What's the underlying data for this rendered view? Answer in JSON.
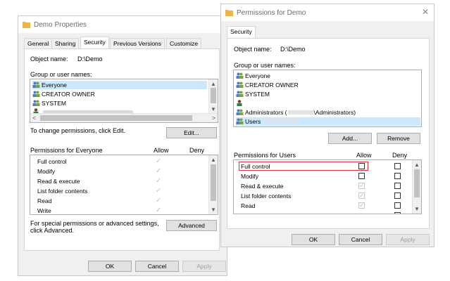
{
  "demo": {
    "title": "Demo Properties",
    "tabs": [
      "General",
      "Sharing",
      "Security",
      "Previous Versions",
      "Customize"
    ],
    "object_name_label": "Object name:",
    "object_name_value": "D:\\Demo",
    "group_label": "Group or user names:",
    "users": [
      "Everyone",
      "CREATOR OWNER",
      "SYSTEM"
    ],
    "change_text": "To change permissions, click Edit.",
    "edit_label": "Edit...",
    "perms_header": "Permissions for Everyone",
    "allow_label": "Allow",
    "deny_label": "Deny",
    "perms": [
      "Full control",
      "Modify",
      "Read & execute",
      "List folder contents",
      "Read",
      "Write"
    ],
    "special_text_1": "For special permissions or advanced settings,",
    "special_text_2": "click Advanced.",
    "advanced_label": "Advanced",
    "ok_label": "OK",
    "cancel_label": "Cancel",
    "apply_label": "Apply"
  },
  "perm": {
    "title": "Permissions for Demo",
    "tab": "Security",
    "object_name_label": "Object name:",
    "object_name_value": "D:\\Demo",
    "group_label": "Group or user names:",
    "users": [
      "Everyone",
      "CREATOR OWNER",
      "SYSTEM",
      "",
      "Administrators (",
      "\\Administrators)",
      "Users"
    ],
    "add_label": "Add...",
    "remove_label": "Remove",
    "perms_header": "Permissions for Users",
    "allow_label": "Allow",
    "deny_label": "Deny",
    "perms": [
      "Full control",
      "Modify",
      "Read & execute",
      "List folder contents",
      "Read"
    ],
    "ok_label": "OK",
    "cancel_label": "Cancel",
    "apply_label": "Apply"
  },
  "colors": {
    "selection": "#cce8ff",
    "highlight_box": "#e0303a",
    "folder": "#e8b84a"
  }
}
